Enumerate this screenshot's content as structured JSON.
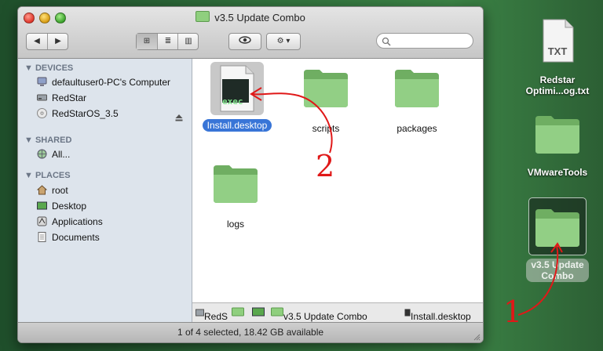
{
  "window": {
    "title": "v3.5 Update Combo",
    "toolbar": {
      "back_label": "◀",
      "forward_label": "▶",
      "view_icon_label": "⊞",
      "view_list_label": "≣",
      "view_column_label": "▥",
      "quicklook_label": "👁",
      "action_label": "⚙ ▾",
      "search_placeholder": "",
      "search_value": ""
    }
  },
  "sidebar": {
    "devices_header": "DEVICES",
    "devices": [
      {
        "label": "defaultuser0-PC's Computer",
        "icon": "computer-icon"
      },
      {
        "label": "RedStar",
        "icon": "harddisk-icon"
      },
      {
        "label": "RedStarOS_3.5",
        "icon": "disc-icon"
      }
    ],
    "shared_header": "SHARED",
    "shared": [
      {
        "label": "All...",
        "icon": "network-icon"
      }
    ],
    "places_header": "PLACES",
    "places": [
      {
        "label": "root",
        "icon": "home-icon"
      },
      {
        "label": "Desktop",
        "icon": "desktop-icon"
      },
      {
        "label": "Applications",
        "icon": "applications-icon"
      },
      {
        "label": "Documents",
        "icon": "documents-icon"
      }
    ]
  },
  "content": {
    "items": [
      {
        "label": "Install.desktop",
        "type": "exec",
        "icon_text": "exec",
        "selected": true
      },
      {
        "label": "scripts",
        "type": "folder",
        "selected": false
      },
      {
        "label": "packages",
        "type": "folder",
        "selected": false
      },
      {
        "label": "logs",
        "type": "folder",
        "selected": false
      }
    ]
  },
  "pathbar": {
    "seg1": "RedS",
    "seg2": "v3.5 Update Combo",
    "seg3": "Install.desktop"
  },
  "status": "1 of 4 selected, 18.42 GB available",
  "desktop": {
    "items": [
      {
        "label": "Redstar Optimi...og.txt",
        "line1": "Redstar",
        "line2": "Optimi...og.txt",
        "icon_text": "TXT"
      },
      {
        "label": "VMwareTools"
      },
      {
        "label": "v3.5 Update Combo",
        "line1": "v3.5 Update",
        "line2": "Combo"
      }
    ]
  },
  "annotations": {
    "label_1": "1",
    "label_2": "2"
  },
  "colors": {
    "selection": "#3875d7",
    "folder_green": "#8fcf7e",
    "annotation_red": "#e01818",
    "sidebar_bg": "#dde4ec"
  }
}
